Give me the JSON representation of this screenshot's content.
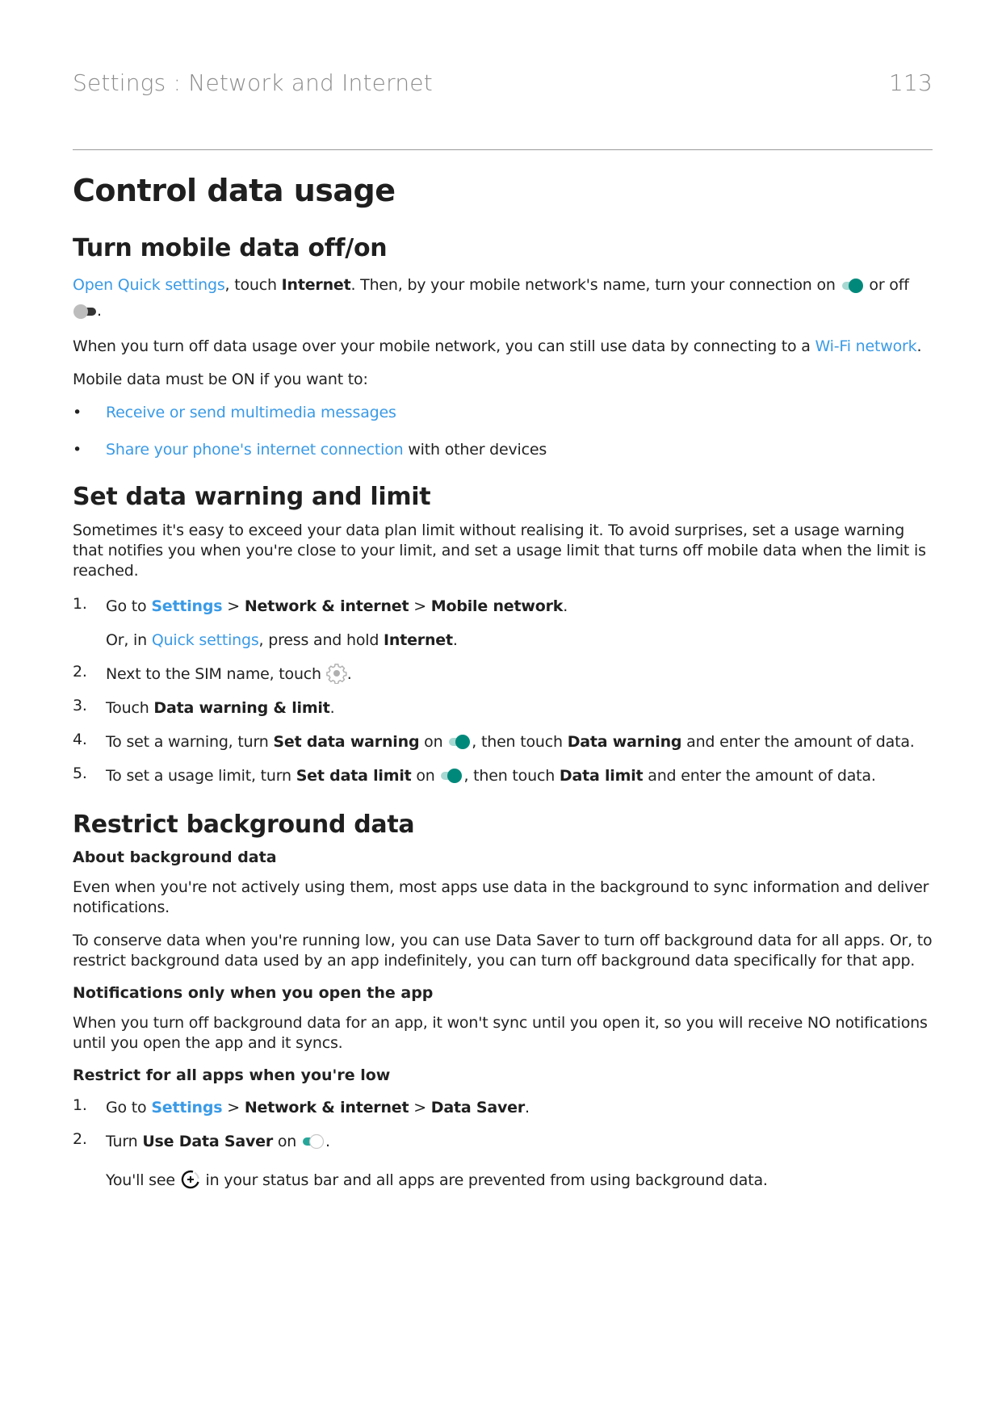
{
  "header": {
    "running_title": "Settings : Network and Internet",
    "page_number": "113"
  },
  "page_title": "Control data usage",
  "section_mobile": {
    "heading": "Turn mobile data off/on",
    "p1": {
      "link": "Open Quick settings",
      "t1": ", touch ",
      "b1": "Internet",
      "t2": ". Then, by your mobile network's name, turn your connection on ",
      "t3": " or off ",
      "t4": "."
    },
    "p2": {
      "t1": "When you turn off data usage over your mobile network, you can still use data by connecting to a ",
      "link": "Wi-Fi network",
      "t2": "."
    },
    "p3": "Mobile data must be ON if you want to:",
    "bullets": [
      {
        "link": "Receive or send multimedia messages",
        "rest": ""
      },
      {
        "link": "Share your phone's internet connection",
        "rest": " with other devices"
      }
    ],
    "bullet_glyph": "•"
  },
  "section_warning": {
    "heading": "Set data warning and limit",
    "intro": "Sometimes it's easy to exceed your data plan limit without realising it. To avoid surprises, set a usage warning that notifies you when you're close to your limit, and set a usage limit that turns off mobile data when the limit is reached.",
    "steps": [
      {
        "num": "1.",
        "t1": "Go to ",
        "link": "Settings",
        "sep1": " > ",
        "b1": "Network & internet",
        "sep2": " > ",
        "b2": "Mobile network",
        "end": ".",
        "note": {
          "t1": "Or, in ",
          "link": "Quick settings",
          "t2": ", press and hold ",
          "b1": "Internet",
          "t3": "."
        }
      },
      {
        "num": "2.",
        "t1": "Next to the SIM name, touch ",
        "end": "."
      },
      {
        "num": "3.",
        "t1": "Touch ",
        "b1": "Data warning & limit",
        "end": "."
      },
      {
        "num": "4.",
        "t1": "To set a warning, turn ",
        "b1": "Set data warning",
        "t2": " on ",
        "t3": ", then touch ",
        "b2": "Data warning",
        "t4": " and enter the amount of data."
      },
      {
        "num": "5.",
        "t1": "To set a usage limit, turn ",
        "b1": "Set data limit",
        "t2": " on ",
        "t3": ", then touch ",
        "b2": "Data limit",
        "t4": " and enter the amount of data."
      }
    ]
  },
  "section_background": {
    "heading": "Restrict background data",
    "about_heading": "About background data",
    "about_p1": "Even when you're not actively using them, most apps use data in the background to sync information and deliver notifications.",
    "about_p2": "To conserve data when you're running low, you can use Data Saver to turn off background data for all apps. Or, to restrict background data used by an app indefinitely, you can turn off background data specifically for that app.",
    "notif_heading": "Notifications only when you open the app",
    "notif_p": "When you turn off background data for an app, it won't sync until you open it, so you will receive NO notifications until you open the app and it syncs.",
    "restrict_heading": "Restrict for all apps when you're low",
    "steps": [
      {
        "num": "1.",
        "t1": "Go to ",
        "link": "Settings",
        "sep1": " > ",
        "b1": "Network & internet",
        "sep2": " > ",
        "b2": "Data Saver",
        "end": "."
      },
      {
        "num": "2.",
        "t1": "Turn ",
        "b1": "Use Data Saver",
        "t2": " on ",
        "end": ".",
        "note": {
          "t1": "You'll see ",
          "t2": " in your status bar and all apps are prevented from using background data."
        }
      }
    ]
  },
  "colors": {
    "link": "#3a9ae6",
    "toggle_on_thumb": "#00897b",
    "toggle_on_track": "#a8d8d2",
    "toggle_off_thumb": "#bdbdbd",
    "toggle_off_track": "#333333"
  }
}
